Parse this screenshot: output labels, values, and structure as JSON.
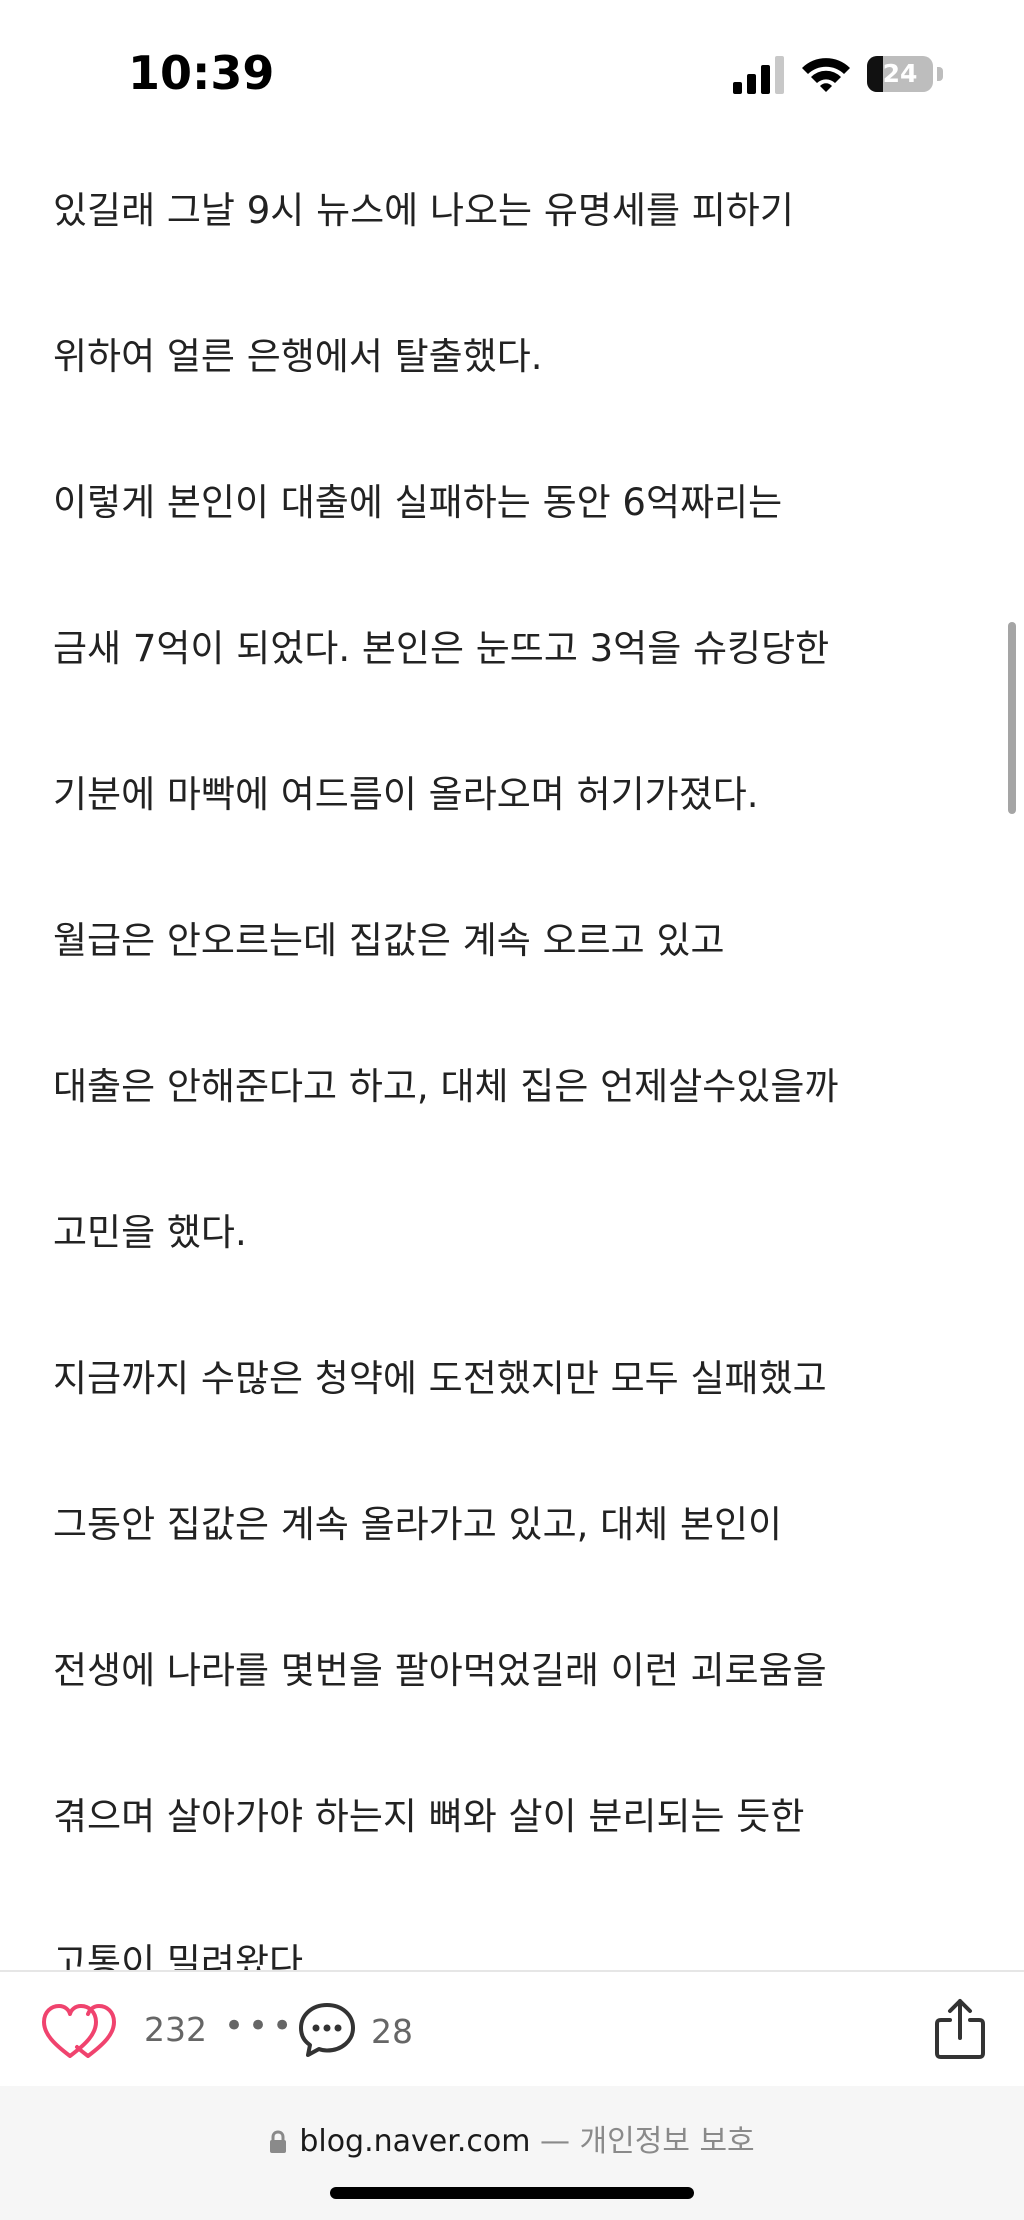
{
  "status_bar": {
    "time": "10:39",
    "battery_level": "24"
  },
  "article": {
    "lines": [
      "있길래 그날 9시 뉴스에 나오는 유명세를 피하기",
      "위하여 얼른 은행에서 탈출했다.",
      "이렇게 본인이 대출에 실패하는 동안 6억짜리는",
      "금새 7억이 되었다. 본인은 눈뜨고 3억을 슈킹당한",
      "기분에 마빡에 여드름이 올라오며 허기가졌다.",
      "월급은 안오르는데 집값은 계속 오르고 있고",
      "대출은 안해준다고 하고, 대체 집은 언제살수있을까",
      "고민을 했다.",
      "지금까지 수많은 청약에 도전했지만 모두 실패했고",
      "그동안 집값은 계속 올라가고 있고, 대체 본인이",
      "전생에 나라를 몇번을 팔아먹었길래 이런 괴로움을",
      "겪으며 살아가야 하는지 뼈와 살이 분리되는 듯한",
      "고통이 밀려왔다"
    ]
  },
  "actions": {
    "like_count": "232",
    "more_label": "•••",
    "comment_count": "28",
    "heart_color": "#f0436e"
  },
  "address_bar": {
    "domain": "blog.naver.com",
    "privacy_label": "— 개인정보 보호"
  }
}
